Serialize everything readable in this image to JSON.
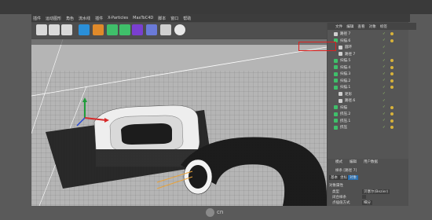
{
  "menubar": {
    "items": [
      "插件",
      "运动图形",
      "角色",
      "流水线",
      "插件",
      "X-Particles",
      "MaxToC4D",
      "脚本",
      "窗口",
      "帮助"
    ]
  },
  "toolbar": {
    "icons": [
      "clapper-icon",
      "clapper-icon",
      "clapper-icon",
      "cube-icon",
      "pen-icon",
      "subdivision-icon",
      "cloner-icon",
      "deformer-icon",
      "scene-icon",
      "camera-icon",
      "light-icon"
    ]
  },
  "object_manager": {
    "tabs": [
      "文件",
      "编辑",
      "查看",
      "对象",
      "标签"
    ],
    "objects": [
      "路径 7",
      "扫描.6",
      "圆环",
      "路径 7",
      "扫描.5",
      "扫描.4",
      "扫描.3",
      "扫描.2",
      "扫描.1",
      "矩形",
      "路径.6",
      "扫描",
      "挤压.2",
      "挤压.1",
      "挤压"
    ]
  },
  "attributes": {
    "tabs": [
      "模式",
      "编辑",
      "用户数据"
    ],
    "object_label": "样条 [路径 7]",
    "subtabs": [
      "基本",
      "坐标",
      "对象"
    ],
    "section": "对象属性",
    "fields": [
      {
        "label": "类型",
        "value": "贝塞尔(Bezier)"
      },
      {
        "label": "闭合样条",
        "value": ""
      },
      {
        "label": "点插值方式",
        "value": "细分"
      }
    ]
  },
  "watermark": {
    "text": "cn"
  }
}
